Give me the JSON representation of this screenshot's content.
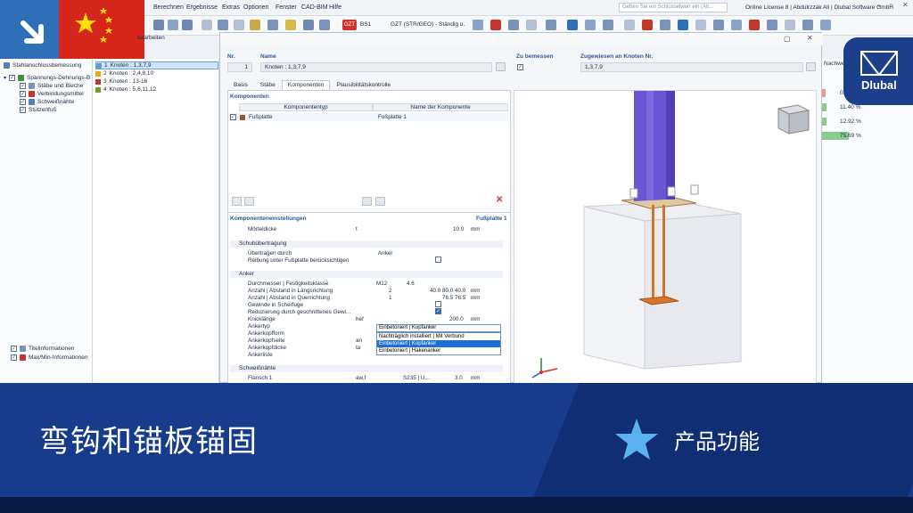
{
  "menu": {
    "items": [
      "Berechnen",
      "Ergebnisse",
      "Extras",
      "Optionen",
      "Fenster",
      "CAD-BIM",
      "Hilfe"
    ],
    "search_placeholder": "Geben Sie ein Schlüsselwort ein (Alt...",
    "license": "Online License 8 | Abdulrzzak Ali | Dlubal Software GmbH",
    "combo_bs": "BS1",
    "combo_gzt": "GZT (STR/GEO) - Ständig u..."
  },
  "navigator": {
    "title": "Stahlanschlussbemessung",
    "root": "Spannungs-Dehnungs-B",
    "items": [
      "Stäbe und Bleche",
      "Verbindungsmittel",
      "Schweißnähte",
      "Stützenfuß"
    ],
    "bottom_items": [
      "Titelinformationen",
      "Max/Min-Informationen"
    ]
  },
  "nodes": {
    "header": "bearbeiten",
    "list": [
      {
        "num": "1",
        "label": "Knoten : 1,3,7,9",
        "color": "#5aa0dc",
        "selected": true
      },
      {
        "num": "2",
        "label": "Knoten : 2,4,8,10",
        "color": "#e6a817",
        "selected": false
      },
      {
        "num": "3",
        "label": "Knoten : 13-16",
        "color": "#c0392b",
        "selected": false
      },
      {
        "num": "4",
        "label": "Knoten : 5,6,11,12",
        "color": "#6aa22a",
        "selected": false
      }
    ]
  },
  "dialog": {
    "nr_label": "Nr.",
    "nr_value": "1",
    "name_label": "Name",
    "name_value": "Knoten : 1,3,7,9",
    "zu_bemessen_label": "Zu bemessen",
    "zugewiesen_label": "Zugewiesen an Knoten Nr.",
    "zugewiesen_value": "1,3,7,9",
    "tabs": [
      "Basis",
      "Stäbe",
      "Komponenten",
      "Plausibilitätskontrolle"
    ],
    "active_tab": "Komponenten",
    "komponenten_title": "Komponenten",
    "col_type": "Komponententyp",
    "col_name": "Name der Komponente",
    "component_type": "Fußplatte",
    "component_name": "Fußplatte 1",
    "settings_title": "Komponenteneinstellungen",
    "settings_sub": "Fußplatte 1",
    "rows": {
      "moertel_label": "Mörteldicke",
      "moertel_sym": "t",
      "moertel_val": "10.0",
      "moertel_unit": "mm",
      "schub_group": "Schubübertragung",
      "uebertragen_label": "Übertragen durch",
      "uebertragen_val": "Anker",
      "reibung_label": "Reibung unter Fußplatte berücksichtigen",
      "anker_group": "Anker",
      "durchmesser_label": "Durchmesser | Festigkeitsklasse",
      "durchmesser_val": "M12",
      "festigkeit_val": "4.6",
      "laengs_label": "Anzahl | Abstand in Längsrichtung",
      "laengs_count": "2",
      "laengs_val": "40.0 80.0 40.0",
      "laengs_unit": "mm",
      "quer_label": "Anzahl | Abstand in Querrichtung",
      "quer_count": "1",
      "quer_val": "76.5 76.5",
      "quer_unit": "mm",
      "gewinde_label": "Gewinde in Scherfuge",
      "reduzierung_label": "Reduzierung durch geschnittenes Gewi...",
      "knick_label": "Knicklänge",
      "knick_sym": "hef",
      "knick_val": "200.0",
      "knick_unit": "mm",
      "ankertyp_label": "Ankertyp",
      "ankerkopfform_label": "Ankerkopfform",
      "ankerkopfseite_label": "Ankerkopfseite",
      "ankerkopfseite_sym": "an",
      "ankerkopfdicke_label": "Ankerkopfdicke",
      "ankerkopfdicke_sym": "ta",
      "ankerliste_label": "Ankerliste",
      "schweiss_group": "Schweißnähte",
      "flansch_label": "Flansch 1",
      "flansch_sym": "aw,f",
      "flansch_val": "S235 | U...",
      "flansch_size": "3.0",
      "flansch_unit": "mm"
    },
    "dropdown_value": "Einbetoniert | Kopfanker",
    "dropdown_options": [
      "Nachträglich installiert | Mit Verbund",
      "Einbetoniert | Kopfanker",
      "Einbetoniert | Hakenanker"
    ],
    "dropdown_highlight": 1
  },
  "results": {
    "header": "Nachwe",
    "values": [
      "0.00 %",
      "11.40 %",
      "12.92 %",
      "75.69 %"
    ],
    "bar_fractions": [
      0.0,
      0.114,
      0.129,
      0.757
    ],
    "bar_colors": [
      "#e57373",
      "#66bb6a",
      "#66bb6a",
      "#66bb6a"
    ]
  },
  "brand": {
    "name": "Dlubal"
  },
  "banner": {
    "title": "弯钩和锚板锚固",
    "category": "产品功能"
  },
  "colors": {
    "banner_blue": "#173c8c",
    "accent_blue": "#2f6fb7",
    "column_purple": "#6a55d4",
    "plate_orange": "#d8742a"
  }
}
